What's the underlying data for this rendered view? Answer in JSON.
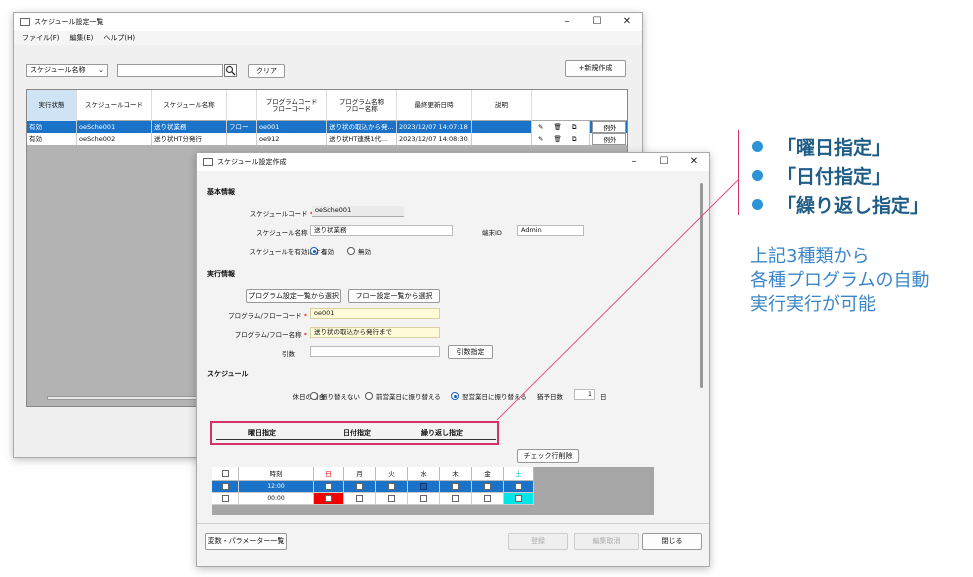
{
  "main_window": {
    "title": "スケジュール設定一覧",
    "menu": [
      "ファイル(F)",
      "編集(E)",
      "ヘルプ(H)"
    ],
    "search_field": {
      "selected": "スケジュール名称",
      "value": ""
    },
    "clear_label": "クリア",
    "new_label": "+新規作成",
    "columns": [
      "実行状態",
      "スケジュールコード",
      "スケジュール名称",
      "",
      "プログラムコード\nフローコード",
      "プログラム名称\nフロー名称",
      "最終更新日時",
      "説明"
    ],
    "rows": [
      {
        "status": "有効",
        "code": "oeSche001",
        "name": "送り状業務",
        "type": "フロー",
        "prog_code": "oe001",
        "prog_name": "送り状の取込から発...",
        "updated": "2023/12/07 14:07:18",
        "desc": "",
        "exception": "例外"
      },
      {
        "status": "有効",
        "code": "oeSche002",
        "name": "送り状HT分発行",
        "type": "",
        "prog_code": "oe912",
        "prog_name": "送り状HT連携1代...",
        "updated": "2023/12/07 14:08:30",
        "desc": "",
        "exception": "例外"
      }
    ]
  },
  "dialog": {
    "title": "スケジュール設定作成",
    "sections": {
      "basic": "基本情報",
      "exec": "実行情報",
      "schedule": "スケジュール"
    },
    "labels": {
      "schedule_code": "スケジュールコード",
      "schedule_name": "スケジュール名称",
      "terminal_id": "端末ID",
      "enable": "スケジュールを有効にする",
      "prog_code": "プログラム/フローコード",
      "prog_name": "プログラム/フロー名称",
      "args": "引数",
      "holiday": "休日の場合",
      "slack_days": "猶予日数",
      "day_unit": "日"
    },
    "required_mark": "*",
    "values": {
      "schedule_code": "oeSche001",
      "schedule_name": "送り状業務",
      "terminal_id": "Admin",
      "prog_code": "oe001",
      "prog_name": "送り状の取込から発行まで",
      "args": "",
      "slack_days": "1"
    },
    "enable_options": [
      "有効",
      "無効"
    ],
    "holiday_options": [
      "振り替えない",
      "前営業日に振り替える",
      "翌営業日に振り替える"
    ],
    "buttons": {
      "select_program": "プログラム設定一覧から選択",
      "select_flow": "フロー設定一覧から選択",
      "args_spec": "引数指定",
      "delete_checked": "チェック行削除",
      "var_param": "変数・パラメーター一覧",
      "register": "登録",
      "cancel_edit": "編集取消",
      "close": "閉じる"
    },
    "tabs": [
      "曜日指定",
      "日付指定",
      "繰り返し指定"
    ],
    "table": {
      "columns": [
        "",
        "時刻",
        "日",
        "月",
        "火",
        "水",
        "木",
        "金",
        "土"
      ],
      "rows": [
        {
          "time": "12:00",
          "days": [
            false,
            false,
            false,
            true,
            false,
            false,
            false
          ]
        },
        {
          "time": "00:00",
          "days": [
            false,
            false,
            false,
            false,
            false,
            false,
            false
          ]
        }
      ]
    }
  },
  "annotation": {
    "bullets": [
      "「曜日指定」",
      "「日付指定」",
      "「繰り返し指定」"
    ],
    "lines": [
      "上記3種類から",
      "各種プログラムの自動",
      "実行実行が可能"
    ]
  },
  "colors": {
    "accent": "#1a5fb4",
    "highlight_box": "#d6336c",
    "bullet": "#2c93d6",
    "sunday": "#e00000",
    "saturday": "#00e5e5"
  }
}
